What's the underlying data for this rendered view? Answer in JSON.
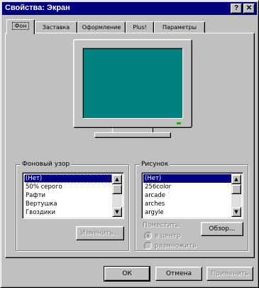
{
  "window": {
    "title": "Свойства: Экран",
    "help_btn": "?",
    "close_btn": "✕"
  },
  "tabs": [
    {
      "label": "Фон",
      "active": true
    },
    {
      "label": "Заставка"
    },
    {
      "label": "Оформление"
    },
    {
      "label": "Plus!"
    },
    {
      "label": "Параметры"
    }
  ],
  "pattern": {
    "group_label": "Фоновый узор",
    "items": [
      "(Нет)",
      "50% серого",
      "Рафти",
      "Вертушка",
      "Гвоздики"
    ],
    "selected_index": 0,
    "edit_button": "Изменить..."
  },
  "wallpaper": {
    "group_label": "Рисунок",
    "items": [
      "(Нет)",
      "256color",
      "arcade",
      "arches",
      "argyle"
    ],
    "selected_index": 0,
    "browse_button": "Обзор...",
    "display_label": "Поместить:",
    "options": [
      "в центр",
      "размножить"
    ],
    "selected_option": 0
  },
  "footer": {
    "ok": "ОК",
    "cancel": "Отмена",
    "apply": "Применить"
  },
  "colors": {
    "desktop": "#008080",
    "titlebar": "#000080",
    "face": "#c0c0c0"
  }
}
